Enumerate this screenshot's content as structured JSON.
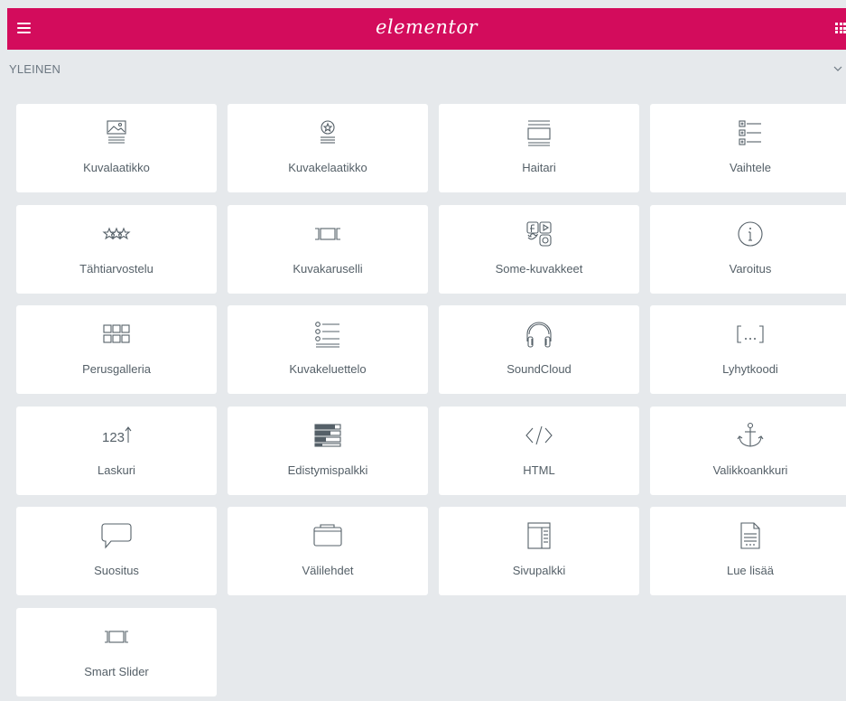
{
  "header": {
    "logo_text": "elementor",
    "brand_color": "#d30c5c",
    "menu_icon": "hamburger-icon",
    "apps_icon": "grid-icon"
  },
  "section": {
    "title": "YLEINEN",
    "toggle_icon": "chevron-down-icon"
  },
  "widgets": [
    {
      "label": "Kuvalaatikko",
      "icon": "image-box-icon"
    },
    {
      "label": "Kuvakelaatikko",
      "icon": "icon-box-icon"
    },
    {
      "label": "Haitari",
      "icon": "accordion-icon"
    },
    {
      "label": "Vaihtele",
      "icon": "toggle-icon"
    },
    {
      "label": "Tähtiarvostelu",
      "icon": "star-rating-icon"
    },
    {
      "label": "Kuvakaruselli",
      "icon": "image-carousel-icon"
    },
    {
      "label": "Some-kuvakkeet",
      "icon": "social-icons-icon"
    },
    {
      "label": "Varoitus",
      "icon": "alert-icon"
    },
    {
      "label": "Perusgalleria",
      "icon": "gallery-icon"
    },
    {
      "label": "Kuvakeluettelo",
      "icon": "icon-list-icon"
    },
    {
      "label": "SoundCloud",
      "icon": "headphones-icon"
    },
    {
      "label": "Lyhytkoodi",
      "icon": "shortcode-icon"
    },
    {
      "label": "Laskuri",
      "icon": "counter-icon"
    },
    {
      "label": "Edistymispalkki",
      "icon": "progress-bar-icon"
    },
    {
      "label": "HTML",
      "icon": "code-icon"
    },
    {
      "label": "Valikkoankkuri",
      "icon": "anchor-icon"
    },
    {
      "label": "Suositus",
      "icon": "testimonial-icon"
    },
    {
      "label": "Välilehdet",
      "icon": "tabs-icon"
    },
    {
      "label": "Sivupalkki",
      "icon": "sidebar-icon"
    },
    {
      "label": "Lue lisää",
      "icon": "read-more-icon"
    },
    {
      "label": "Smart Slider",
      "icon": "slider-icon"
    }
  ]
}
